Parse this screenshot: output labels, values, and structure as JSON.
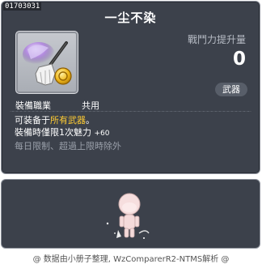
{
  "item": {
    "id": "01703031",
    "name": "一尘不染",
    "power_label": "戰鬥力提升量",
    "power_value": "0",
    "category": "武器",
    "job_label": "裝備職業",
    "job_value": "共用"
  },
  "description": {
    "line1_prefix": "可装备于",
    "line1_highlight": "所有武器",
    "line1_suffix": "。",
    "line2_label": "裝備時僅限1次魅力",
    "line2_value": "+60",
    "line3": "每日限制、超過上限時除外"
  },
  "footer": "@ 数据由小册子整理, WzComparerR2-NTMS解析 @",
  "colors": {
    "panel": "#3c414b",
    "border": "#8c919b",
    "highlight": "#ffcc33",
    "muted": "#9aa0aa"
  },
  "icons": {
    "item_icon": "broom-with-coin-icon",
    "preview_character": "character-preview"
  }
}
